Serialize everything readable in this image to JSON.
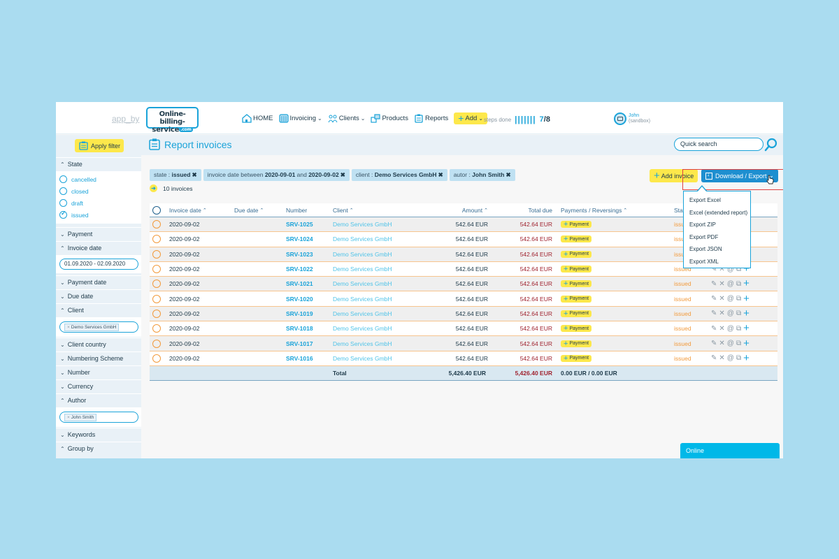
{
  "header": {
    "app_by": "app_by",
    "logo_line1": "Online-billing-",
    "logo_line2": "service",
    "logo_tld": ".com",
    "nav": [
      {
        "label": "HOME",
        "icon": "home-icon",
        "has_dropdown": false
      },
      {
        "label": "Invoicing",
        "icon": "invoicing-icon",
        "has_dropdown": true
      },
      {
        "label": "Clients",
        "icon": "clients-icon",
        "has_dropdown": true
      },
      {
        "label": "Products",
        "icon": "products-icon",
        "has_dropdown": false
      },
      {
        "label": "Reports",
        "icon": "reports-icon",
        "has_dropdown": false
      }
    ],
    "add_label": "Add",
    "steps_label": "steps done",
    "steps_bars": "|||||||",
    "steps_done": "7",
    "steps_total": "/8",
    "user_name": "John",
    "user_env": "(sandbox)",
    "chevron": "⌄"
  },
  "sidebar": {
    "apply_filter": "Apply filter",
    "sections": {
      "state": "State",
      "payment": "Payment",
      "invoice_date": "Invoice date",
      "payment_date": "Payment date",
      "due_date": "Due date",
      "client": "Client",
      "client_country": "Client country",
      "numbering_scheme": "Numbering Scheme",
      "number": "Number",
      "currency": "Currency",
      "author": "Author",
      "keywords": "Keywords",
      "group_by": "Group by"
    },
    "state_options": [
      {
        "label": "cancelled",
        "checked": false
      },
      {
        "label": "closed",
        "checked": false
      },
      {
        "label": "draft",
        "checked": false
      },
      {
        "label": "issued",
        "checked": true
      }
    ],
    "invoice_date_value": "01.09.2020 - 02.09.2020",
    "client_tag": "Demo Services GmbH",
    "author_tag": "John Smith",
    "tag_remove": "×",
    "chev_open": "⌃",
    "chev_closed": "⌄"
  },
  "main": {
    "title": "Report invoices",
    "quick_search_placeholder": "Quick search",
    "filters": [
      {
        "prefix": "state : ",
        "value": "issued"
      },
      {
        "prefix": "invoice date between ",
        "value": "2020-09-01",
        "mid": " and ",
        "value2": "2020-09-02"
      },
      {
        "prefix": "client : ",
        "value": "Demo Services GmbH"
      },
      {
        "prefix": "autor : ",
        "value": "John Smith"
      }
    ],
    "filter_remove": "✖",
    "invoice_count": "10 invoices",
    "add_invoice": "Add invoice",
    "download_export": "Download / Export",
    "export_menu": [
      "Export Excel",
      "Excel (extended report)",
      "Export ZIP",
      "Export PDF",
      "Export JSON",
      "Export XML"
    ]
  },
  "table": {
    "columns": {
      "invoice_date": "Invoice date",
      "due_date": "Due date",
      "number": "Number",
      "client": "Client",
      "amount": "Amount",
      "total_due": "Total due",
      "payments": "Payments / Reversings",
      "state": "State"
    },
    "sort_glyph": "⌃",
    "payment_label": "Payment",
    "rows": [
      {
        "invoice_date": "2020-09-02",
        "due_date": "",
        "number": "SRV-1025",
        "client": "Demo Services GmbH",
        "amount": "542.64 EUR",
        "total_due": "542.64 EUR",
        "state": "issued"
      },
      {
        "invoice_date": "2020-09-02",
        "due_date": "",
        "number": "SRV-1024",
        "client": "Demo Services GmbH",
        "amount": "542.64 EUR",
        "total_due": "542.64 EUR",
        "state": "issued"
      },
      {
        "invoice_date": "2020-09-02",
        "due_date": "",
        "number": "SRV-1023",
        "client": "Demo Services GmbH",
        "amount": "542.64 EUR",
        "total_due": "542.64 EUR",
        "state": "issued"
      },
      {
        "invoice_date": "2020-09-02",
        "due_date": "",
        "number": "SRV-1022",
        "client": "Demo Services GmbH",
        "amount": "542.64 EUR",
        "total_due": "542.64 EUR",
        "state": "issued"
      },
      {
        "invoice_date": "2020-09-02",
        "due_date": "",
        "number": "SRV-1021",
        "client": "Demo Services GmbH",
        "amount": "542.64 EUR",
        "total_due": "542.64 EUR",
        "state": "issued"
      },
      {
        "invoice_date": "2020-09-02",
        "due_date": "",
        "number": "SRV-1020",
        "client": "Demo Services GmbH",
        "amount": "542.64 EUR",
        "total_due": "542.64 EUR",
        "state": "issued"
      },
      {
        "invoice_date": "2020-09-02",
        "due_date": "",
        "number": "SRV-1019",
        "client": "Demo Services GmbH",
        "amount": "542.64 EUR",
        "total_due": "542.64 EUR",
        "state": "issued"
      },
      {
        "invoice_date": "2020-09-02",
        "due_date": "",
        "number": "SRV-1018",
        "client": "Demo Services GmbH",
        "amount": "542.64 EUR",
        "total_due": "542.64 EUR",
        "state": "issued"
      },
      {
        "invoice_date": "2020-09-02",
        "due_date": "",
        "number": "SRV-1017",
        "client": "Demo Services GmbH",
        "amount": "542.64 EUR",
        "total_due": "542.64 EUR",
        "state": "issued"
      },
      {
        "invoice_date": "2020-09-02",
        "due_date": "",
        "number": "SRV-1016",
        "client": "Demo Services GmbH",
        "amount": "542.64 EUR",
        "total_due": "542.64 EUR",
        "state": "issued"
      }
    ],
    "total": {
      "label": "Total",
      "amount": "5,426.40 EUR",
      "total_due": "5,426.40 EUR",
      "payments": "0.00 EUR / 0.00 EUR"
    },
    "actions": [
      "edit-icon",
      "cancel-icon",
      "email-icon",
      "copy-icon",
      "add-icon"
    ]
  },
  "chat": {
    "status": "Online"
  },
  "colors": {
    "accent": "#1aa3d9",
    "highlight_yellow": "#fde84b",
    "state_issued": "#f29a3c",
    "due_red": "#a0232f",
    "export_button": "#1e8fd0",
    "online_bar": "#00b8e8"
  }
}
